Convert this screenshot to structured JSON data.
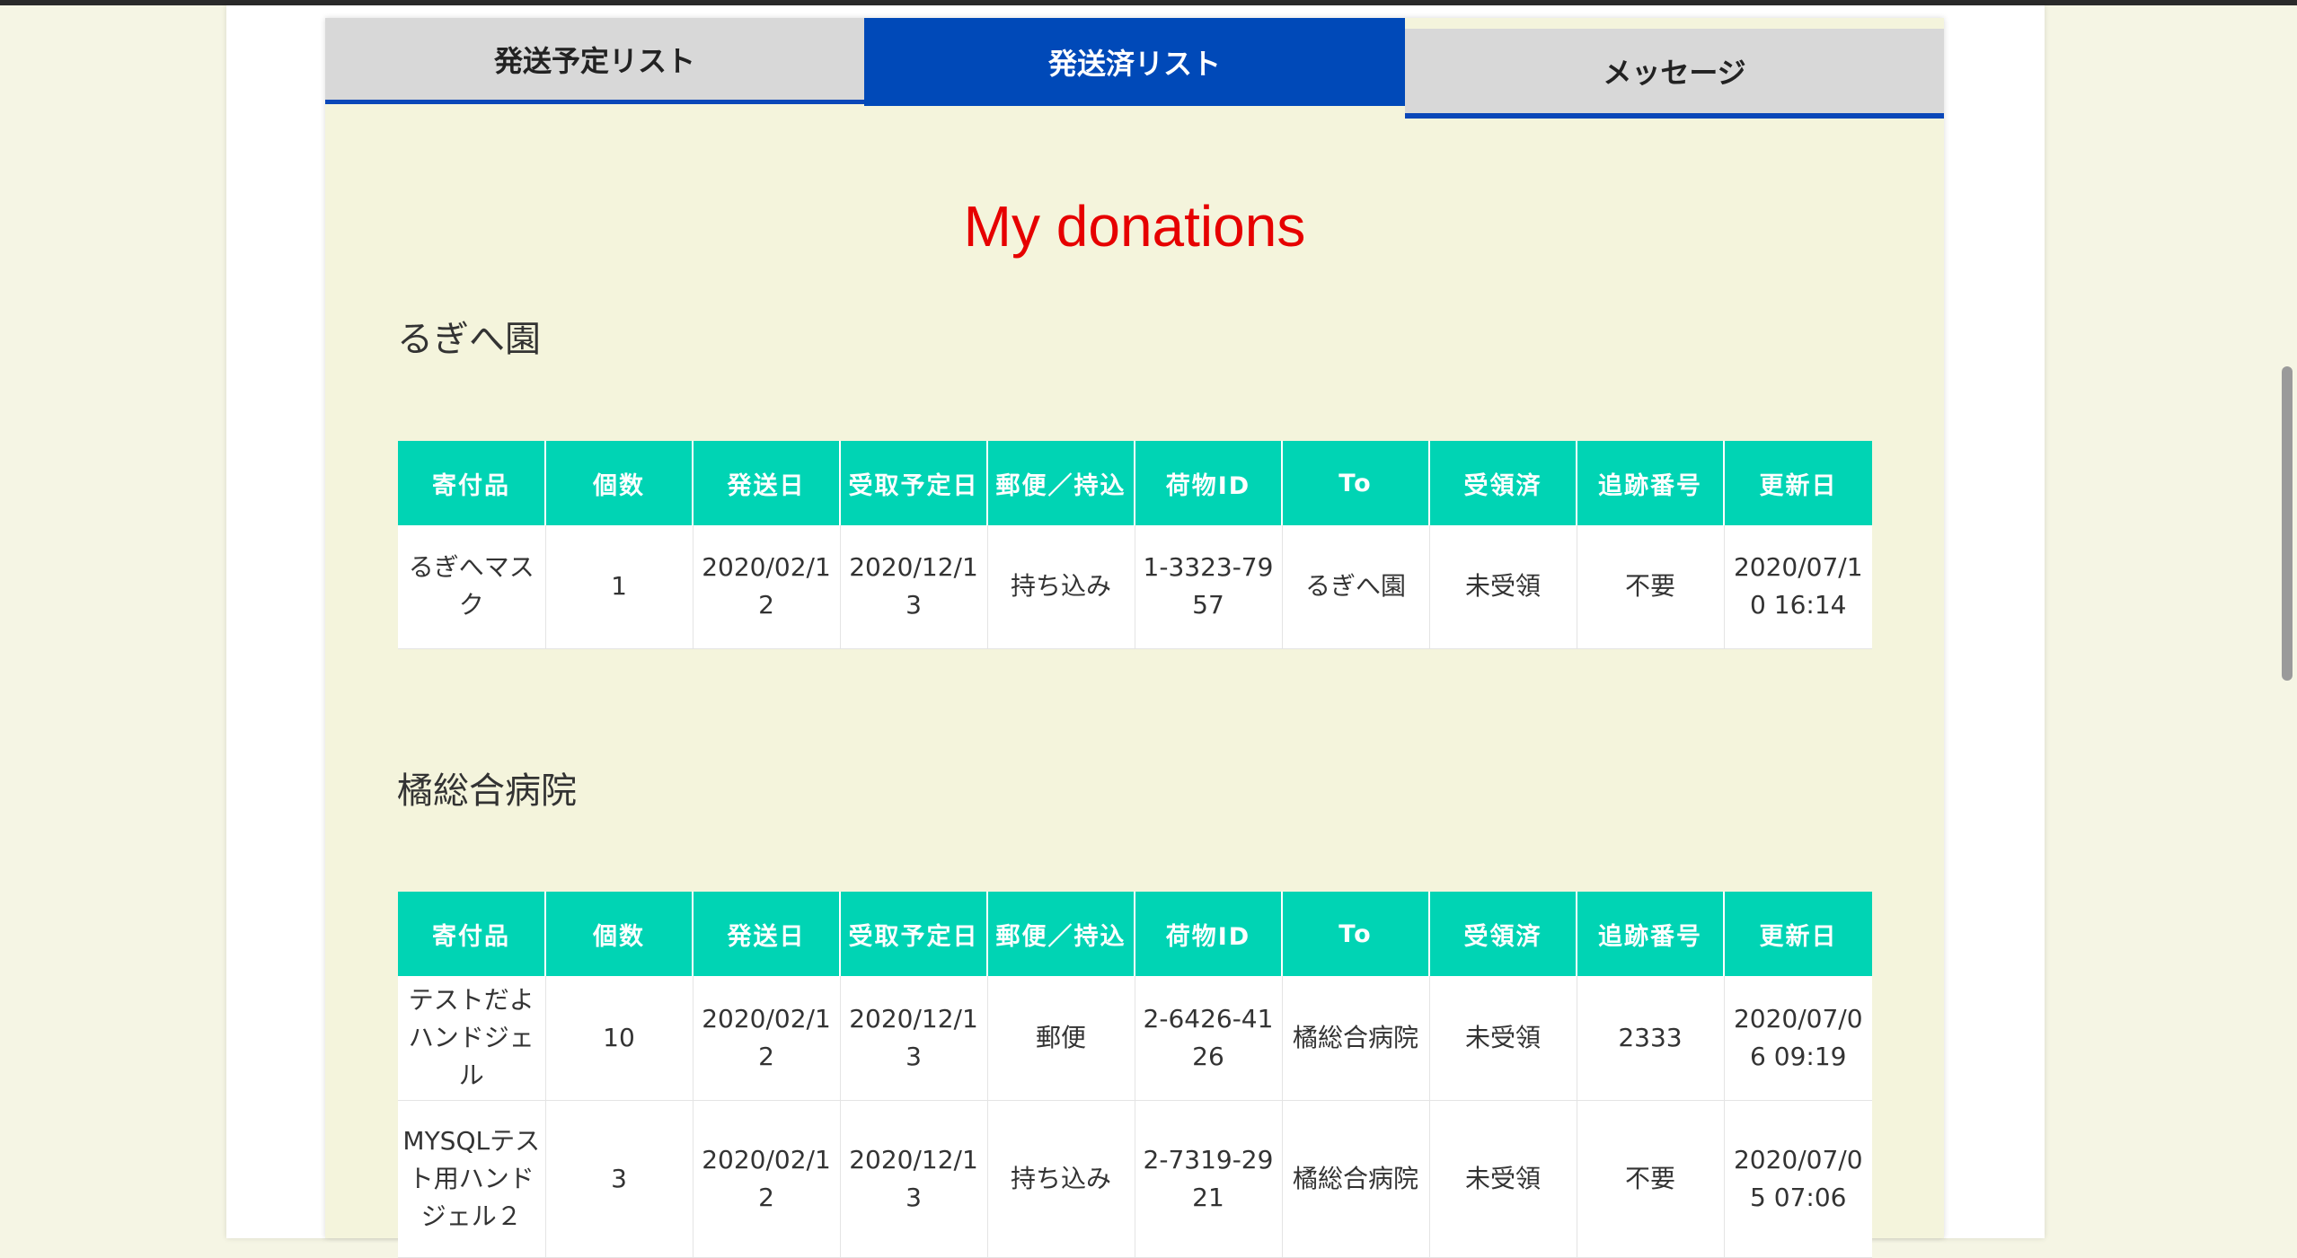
{
  "tabs": [
    {
      "label": "発送予定リスト"
    },
    {
      "label": "発送済リスト"
    },
    {
      "label": "メッセージ"
    }
  ],
  "page_title": "My donations",
  "columns": [
    "寄付品",
    "個数",
    "発送日",
    "受取予定日",
    "郵便／持込",
    "荷物ID",
    "To",
    "受領済",
    "追跡番号",
    "更新日"
  ],
  "groups": [
    {
      "name": "るぎへ園",
      "rows": [
        {
          "item": "るぎへマスク",
          "qty": "1",
          "ship": "2020/02/12",
          "recv": "2020/12/13",
          "method": "持ち込み",
          "pkg": "1-3323-7957",
          "to": "るぎへ園",
          "status": "未受領",
          "track": "不要",
          "updated": "2020/07/10 16:14"
        }
      ]
    },
    {
      "name": "橘総合病院",
      "rows": [
        {
          "item": "テストだよハンドジェル",
          "qty": "10",
          "ship": "2020/02/12",
          "recv": "2020/12/13",
          "method": "郵便",
          "pkg": "2-6426-4126",
          "to": "橘総合病院",
          "status": "未受領",
          "track": "2333",
          "updated": "2020/07/06 09:19"
        },
        {
          "item": "MYSQLテスト用ハンドジェル２",
          "qty": "3",
          "ship": "2020/02/12",
          "recv": "2020/12/13",
          "method": "持ち込み",
          "pkg": "2-7319-2921",
          "to": "橘総合病院",
          "status": "未受領",
          "track": "不要",
          "updated": "2020/07/05 07:06"
        }
      ]
    }
  ],
  "colors": {
    "background": "#f5f5e4",
    "panel": "#f4f4dc",
    "active_tab": "#0049b8",
    "inactive_tab": "#d8d8d8",
    "table_header": "#00d4b4",
    "title": "#e60000"
  }
}
